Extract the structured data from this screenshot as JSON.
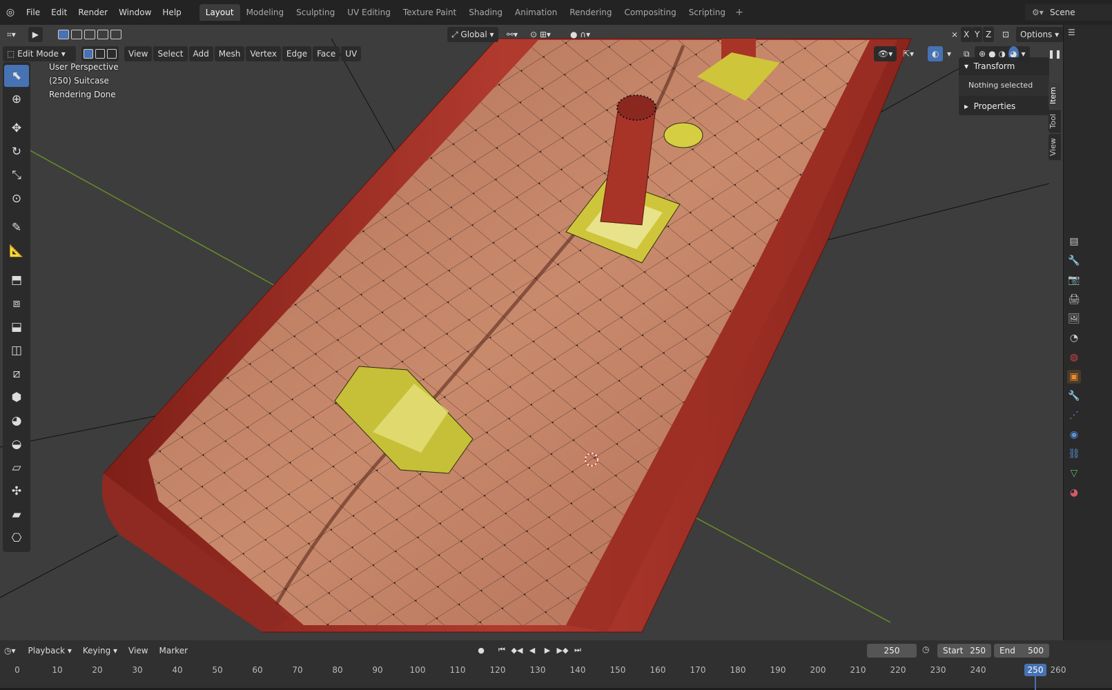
{
  "topbar": {
    "menu": [
      "File",
      "Edit",
      "Render",
      "Window",
      "Help"
    ],
    "tabs": [
      "Layout",
      "Modeling",
      "Sculpting",
      "UV Editing",
      "Texture Paint",
      "Shading",
      "Animation",
      "Rendering",
      "Compositing",
      "Scripting"
    ],
    "active_tab": "Layout",
    "scene": "Scene"
  },
  "viewport_header": {
    "orientation": "Global",
    "options": "Options",
    "axes": [
      "X",
      "Y",
      "Z"
    ],
    "mode": "Edit Mode",
    "menu": [
      "View",
      "Select",
      "Add",
      "Mesh",
      "Vertex",
      "Edge",
      "Face",
      "UV"
    ]
  },
  "overlay": {
    "line1": "User Perspective",
    "line2": "(250) Suitcase",
    "line3": "Rendering Done"
  },
  "npanel": {
    "transform": "Transform",
    "nothing_selected": "Nothing selected",
    "properties": "Properties",
    "side_tabs": [
      "Item",
      "Tool",
      "View"
    ]
  },
  "timeline": {
    "menu": [
      "Playback",
      "Keying",
      "View",
      "Marker"
    ],
    "current": "250",
    "start_label": "Start",
    "start": "250",
    "end_label": "End",
    "end": "500",
    "ruler": [
      "0",
      "10",
      "20",
      "30",
      "40",
      "50",
      "60",
      "70",
      "80",
      "90",
      "100",
      "110",
      "120",
      "130",
      "140",
      "150",
      "160",
      "170",
      "180",
      "190",
      "200",
      "210",
      "220",
      "230",
      "240",
      "250",
      "260"
    ],
    "cursor": "250"
  },
  "colors": {
    "accent": "#4772b3",
    "case_red": "#a8352b",
    "handle_gold": "#d4cc3a"
  }
}
